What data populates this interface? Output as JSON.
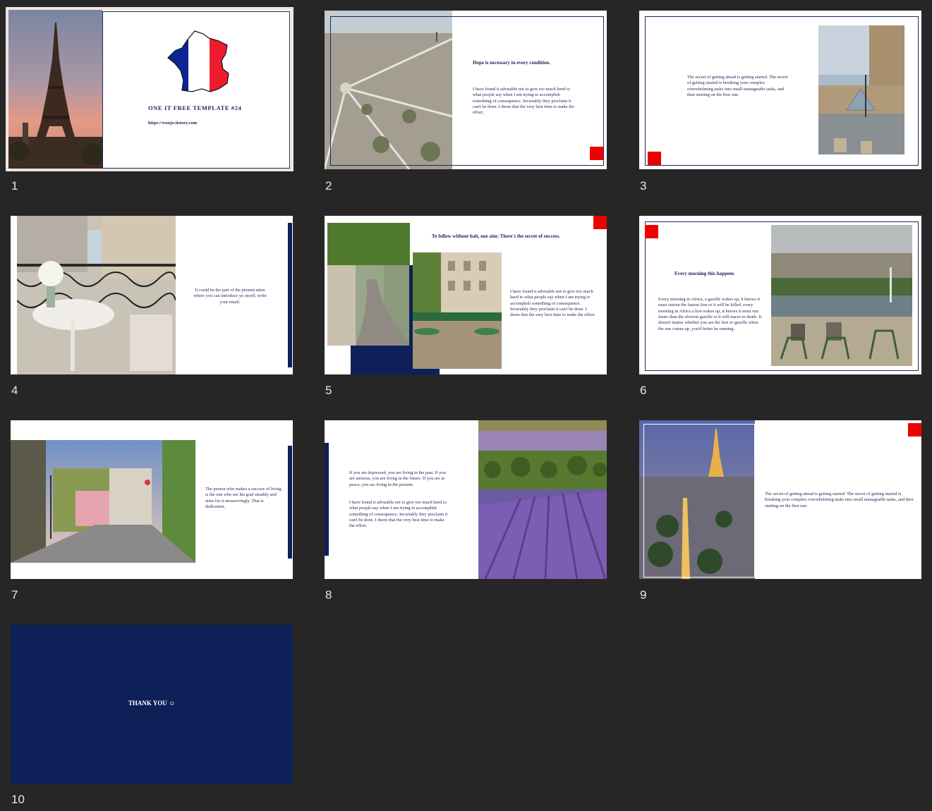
{
  "slides": [
    {
      "number": "1",
      "title": "ONE IT FREE TEMPLATE #24",
      "url": "https://wonjo.tistory.com"
    },
    {
      "number": "2",
      "heading": "Hope is necessary in every condition.",
      "body": "I have found it advisable not to give too much heed to what people say when I am trying to accomplish something of consequence. Invariably they proclaim it can't be done. I deem that the very best time to make the effort."
    },
    {
      "number": "3",
      "body": "The secret of getting ahead is getting started. The secret of getting started is breaking your complex overwhelming tasks into small manageable tasks, and then starting on the first one."
    },
    {
      "number": "4",
      "body": "It could be the part of the present ation where you can introduce yo urself, write your email."
    },
    {
      "number": "5",
      "heading": "To follow without halt, one aim: There's the secret of success.",
      "body": "I have found it advisable not to give too much heed to what people say when I am trying to accomplish something of consequence. Invariably they proclaim it can't be done. I deem that the very best time to make the effort."
    },
    {
      "number": "6",
      "heading": "Every morning this happens",
      "body": "Every morning in Africa, a gazelle wakes up, it knows it must outrun the fastest lion or it will be killed. every morning in Africa a lion wakes up, it knows it must run faster than the slowest gazelle or it will starve to death. It doesn't matter whether you are the lion or gazelle when the sun comes up, you'd better be running."
    },
    {
      "number": "7",
      "body": "The person who makes a success of living is the one who see his goal steadily and aims for it unswervingly. That is dedication."
    },
    {
      "number": "8",
      "body1": "If you are depressed, you are living in the past. If you are anxious, you are living in the future. If you are at peace, you are living in the present.",
      "body2": "I have found it advisable not to give too much heed to what people say when I am trying to accomplish something of consequence. Invariably they proclaim it can't be done. I deem that the very best time to make the effort."
    },
    {
      "number": "9",
      "body": "The secret of getting ahead is getting started. The secret of getting started is breaking your complex overwhelming tasks into small manageable tasks, and then starting on the first one."
    },
    {
      "number": "10",
      "body": "THANK YOU ☺"
    }
  ],
  "colors": {
    "navy": "#0d2058",
    "red": "#ef0000",
    "background": "#262626",
    "selection": "#f1e4dd"
  }
}
